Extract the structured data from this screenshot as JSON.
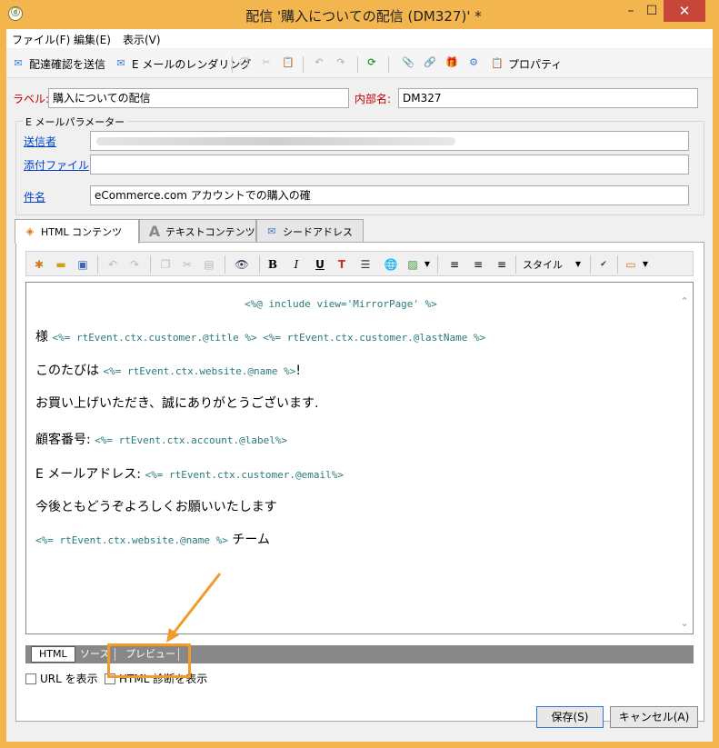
{
  "window": {
    "title": "配信 '購入についての配信 (DM327)' *",
    "app_icon": "ⓓ",
    "minimize": "–",
    "maximize": "☐",
    "close": "✕"
  },
  "menu": [
    "ファイル(F)",
    "編集(E)",
    "表示(V)"
  ],
  "toolbar": {
    "send_proof": "配達確認を送信",
    "email_rendering": "E メールのレンダリング",
    "properties": "プロパティ"
  },
  "form": {
    "label_caption": "ラベル:",
    "label_value": "購入についての配信",
    "internal_name_caption": "内部名:",
    "internal_name_value": "DM327",
    "email_params_title": "E メールパラメーター",
    "sender_caption": "送信者",
    "sender_value": "",
    "attachment_caption": "添付ファイル",
    "attachment_value": "",
    "subject_caption": "件名",
    "subject_value": "eCommerce.com アカウントでの購入の確"
  },
  "tabs": [
    "HTML コンテンツ",
    "テキストコンテンツ",
    "シードアドレス"
  ],
  "editor_toolbar": {
    "bold": "B",
    "italic": "I",
    "underline": "U",
    "style_label": "スタイル"
  },
  "content": {
    "include_line": "<%@ include view='MirrorPage' %>",
    "line1_text": "様",
    "line1_code": "<%= rtEvent.ctx.customer.@title %> <%= rtEvent.ctx.customer.@lastName %>",
    "line2_text": "このたびは",
    "line2_code": "<%= rtEvent.ctx.website.@name %>",
    "line2_end": "!",
    "line3_text": "お買い上げいただき、誠にありがとうございます.",
    "line4_text": "顧客番号:",
    "line4_code": "<%= rtEvent.ctx.account.@label%>",
    "line5_text": "E メールアドレス:",
    "line5_code": "<%= rtEvent.ctx.customer.@email%>",
    "line6_text": "今後ともどうぞよろしくお願いいたします",
    "line7_code": "<%= rtEvent.ctx.website.@name %>",
    "line7_text": "チーム"
  },
  "bottom_tabs": [
    "HTML",
    "ソース",
    "プレビュー"
  ],
  "options": {
    "show_urls": "URL を表示",
    "show_html_diag": "HTML 診断を表示"
  },
  "buttons": {
    "save": "保存(S)",
    "cancel": "キャンセル(A)"
  },
  "colors": {
    "title_bar": "#f3b64f",
    "highlight": "#f29a2a",
    "code": "#2a7a7a",
    "required_label": "#c00000",
    "link": "#0044cc"
  }
}
